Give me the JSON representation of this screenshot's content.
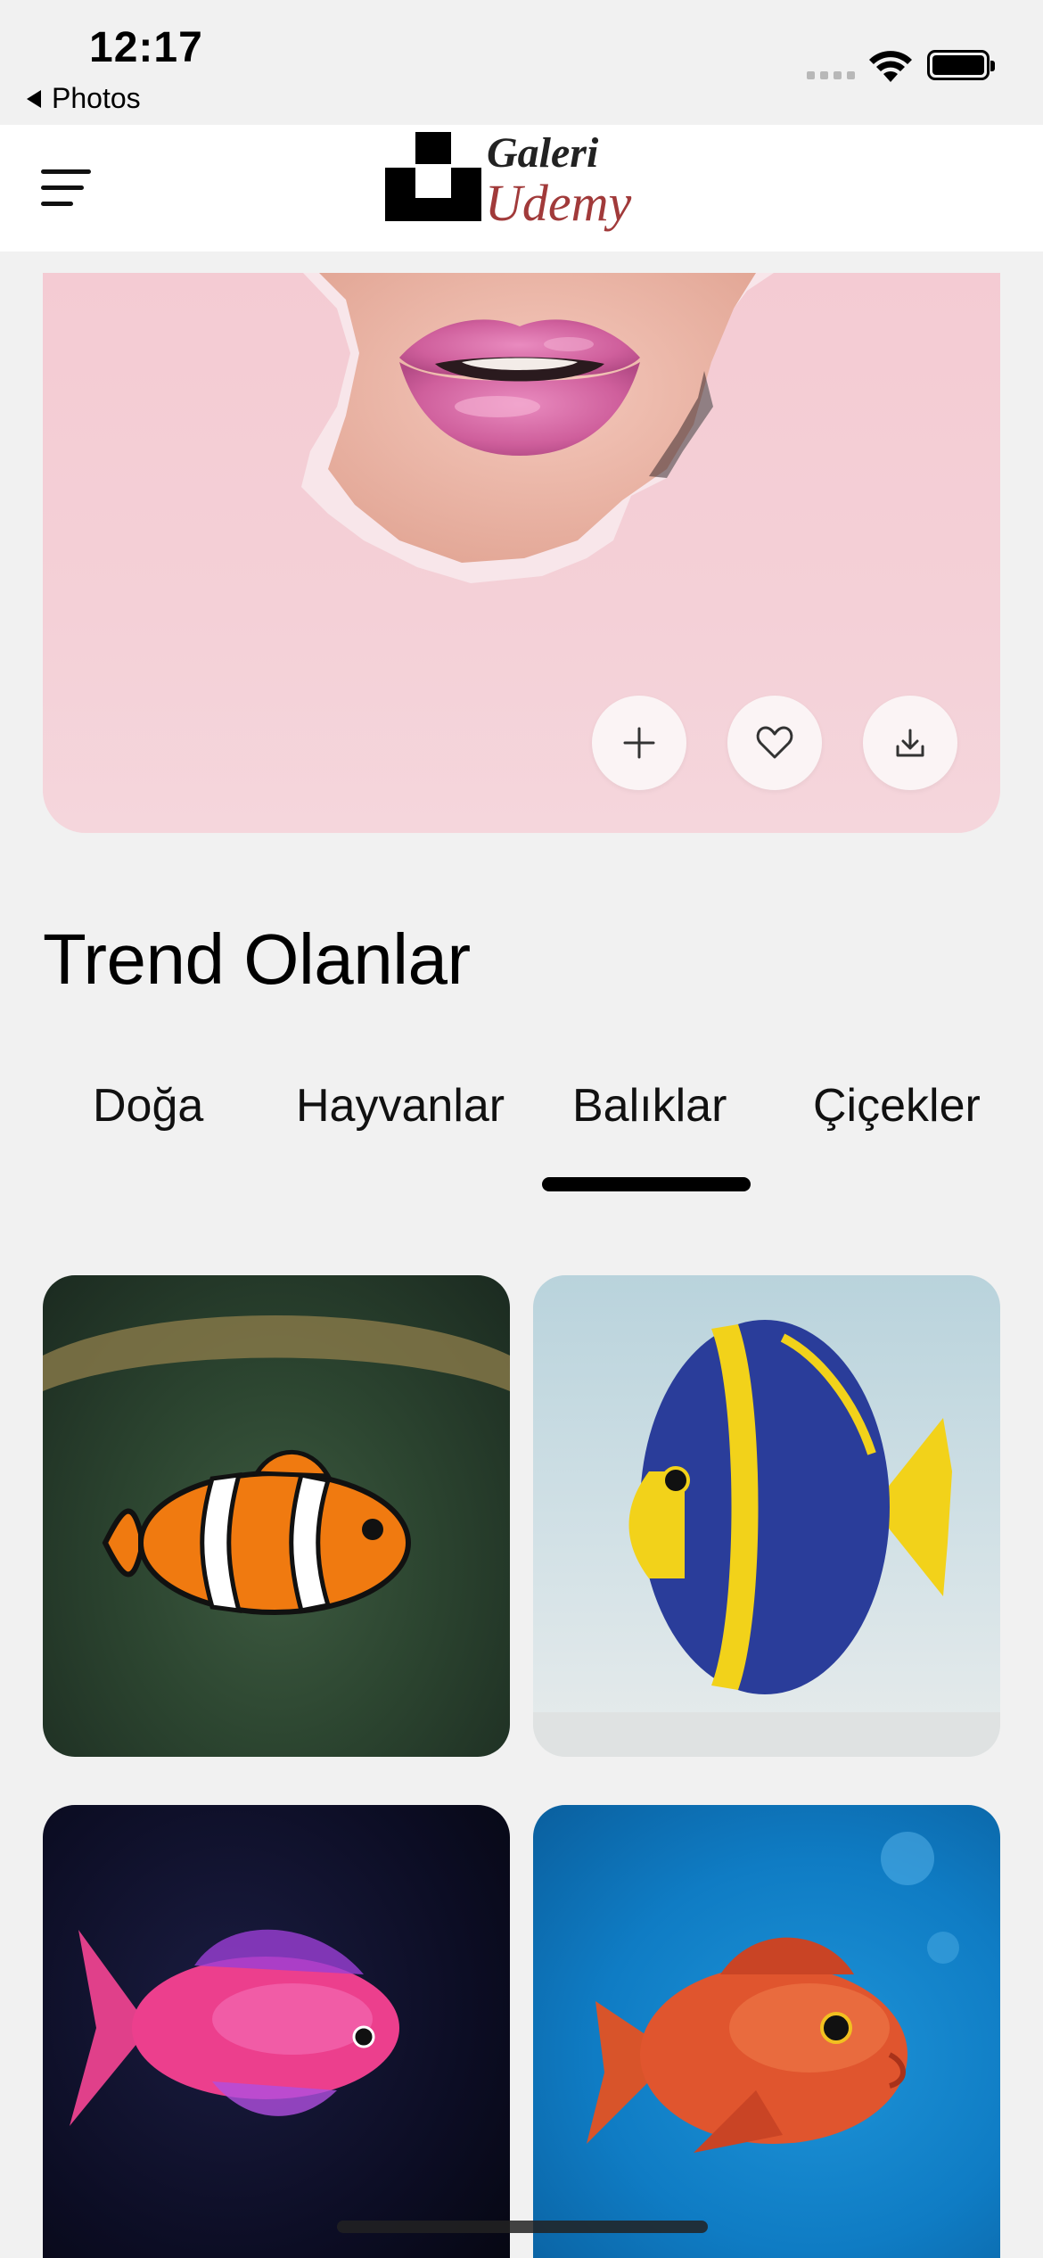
{
  "status_bar": {
    "time": "12:17",
    "back_label": "Photos",
    "icons": [
      "cellular-signal-icon",
      "wifi-icon",
      "battery-icon"
    ]
  },
  "app_bar": {
    "menu_icon": "menu-icon",
    "logo_line_1": "Galeri",
    "logo_line_2": "Udemy"
  },
  "hero": {
    "actions": [
      {
        "name": "add",
        "icon": "plus-icon"
      },
      {
        "name": "favorite",
        "icon": "heart-icon"
      },
      {
        "name": "download",
        "icon": "download-icon"
      }
    ]
  },
  "section_title": "Trend Olanlar",
  "tabs": [
    {
      "label": "Doğa",
      "selected": false
    },
    {
      "label": "Hayvanlar",
      "selected": false
    },
    {
      "label": "Balıklar",
      "selected": true
    },
    {
      "label": "Çiçekler",
      "selected": false
    }
  ],
  "colors": {
    "background": "#f1f1f1",
    "app_bar": "#ffffff",
    "tab_indicator": "#000000",
    "logo_accent": "#a13a3a"
  }
}
